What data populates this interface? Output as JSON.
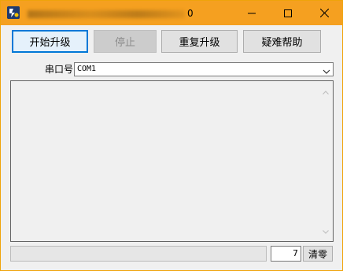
{
  "window": {
    "title_suffix": "0",
    "accent_color": "#f5a020"
  },
  "toolbar": {
    "start_upgrade": "开始升级",
    "stop": "停止",
    "re_upgrade": "重复升级",
    "help": "疑难帮助"
  },
  "port": {
    "label": "串口号",
    "value": "COM1"
  },
  "status": {
    "count": "7",
    "clear_label": "清零"
  }
}
